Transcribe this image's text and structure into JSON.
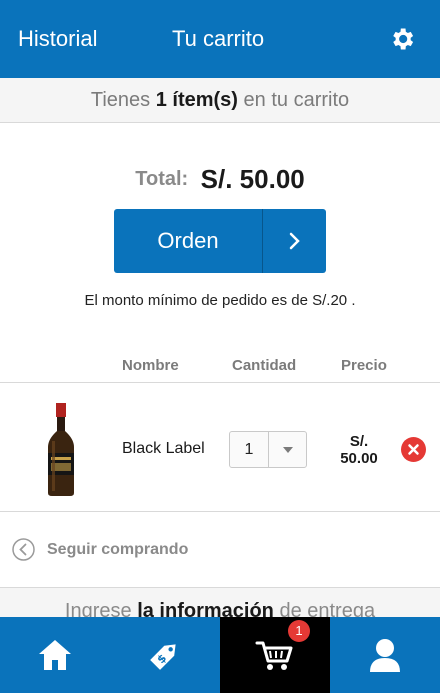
{
  "header": {
    "history_label": "Historial",
    "title": "Tu carrito",
    "settings_icon": "gear-icon"
  },
  "cart_count": {
    "prefix": "Tienes",
    "count": "1 ítem(s)",
    "suffix": "en tu carrito"
  },
  "summary": {
    "total_label": "Total:",
    "total_value": "S/. 50.00",
    "order_label": "Orden",
    "min_note": "El monto mínimo de pedido es de S/.20 ."
  },
  "table": {
    "headers": {
      "name": "Nombre",
      "quantity": "Cantidad",
      "price": "Precio"
    },
    "items": [
      {
        "name": "Black Label",
        "quantity": "1",
        "price_line1": "S/.",
        "price_line2": "50.00",
        "image_icon": "whisky-bottle-icon"
      }
    ]
  },
  "continue_label": "Seguir comprando",
  "delivery": {
    "prefix": "Ingrese",
    "bold": "la información",
    "suffix": "de entrega"
  },
  "tabs": [
    {
      "icon": "home-icon",
      "active": false
    },
    {
      "icon": "tag-icon",
      "active": false
    },
    {
      "icon": "cart-icon",
      "active": true,
      "badge": "1"
    },
    {
      "icon": "user-icon",
      "active": false
    }
  ],
  "colors": {
    "primary": "#0a73bb",
    "active_tab": "#000000",
    "badge": "#e53935",
    "remove": "#e53935"
  }
}
